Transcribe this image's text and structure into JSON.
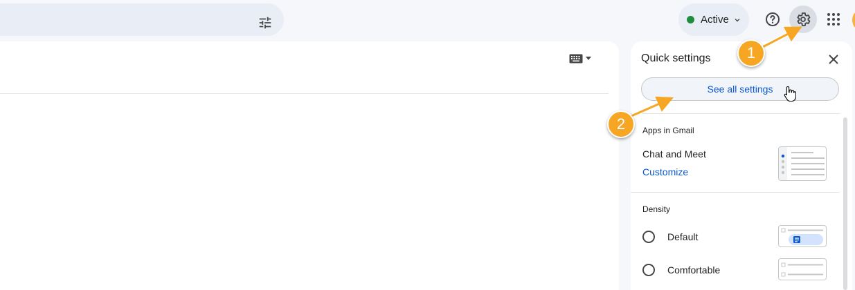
{
  "header": {
    "status": {
      "label": "Active",
      "color": "#1e8e3e"
    },
    "icons": [
      "filter-icon",
      "help-icon",
      "settings-icon",
      "apps-grid-icon",
      "account-avatar"
    ]
  },
  "quick_settings": {
    "title": "Quick settings",
    "see_all_label": "See all settings",
    "apps_section": {
      "heading": "Apps in Gmail",
      "item_label": "Chat and Meet",
      "customize_label": "Customize"
    },
    "density_section": {
      "heading": "Density",
      "options": [
        {
          "label": "Default"
        },
        {
          "label": "Comfortable"
        }
      ]
    }
  },
  "annotations": [
    {
      "number": "1"
    },
    {
      "number": "2"
    }
  ],
  "colors": {
    "accent": "#0b57d0",
    "annotation": "#f6a623"
  }
}
